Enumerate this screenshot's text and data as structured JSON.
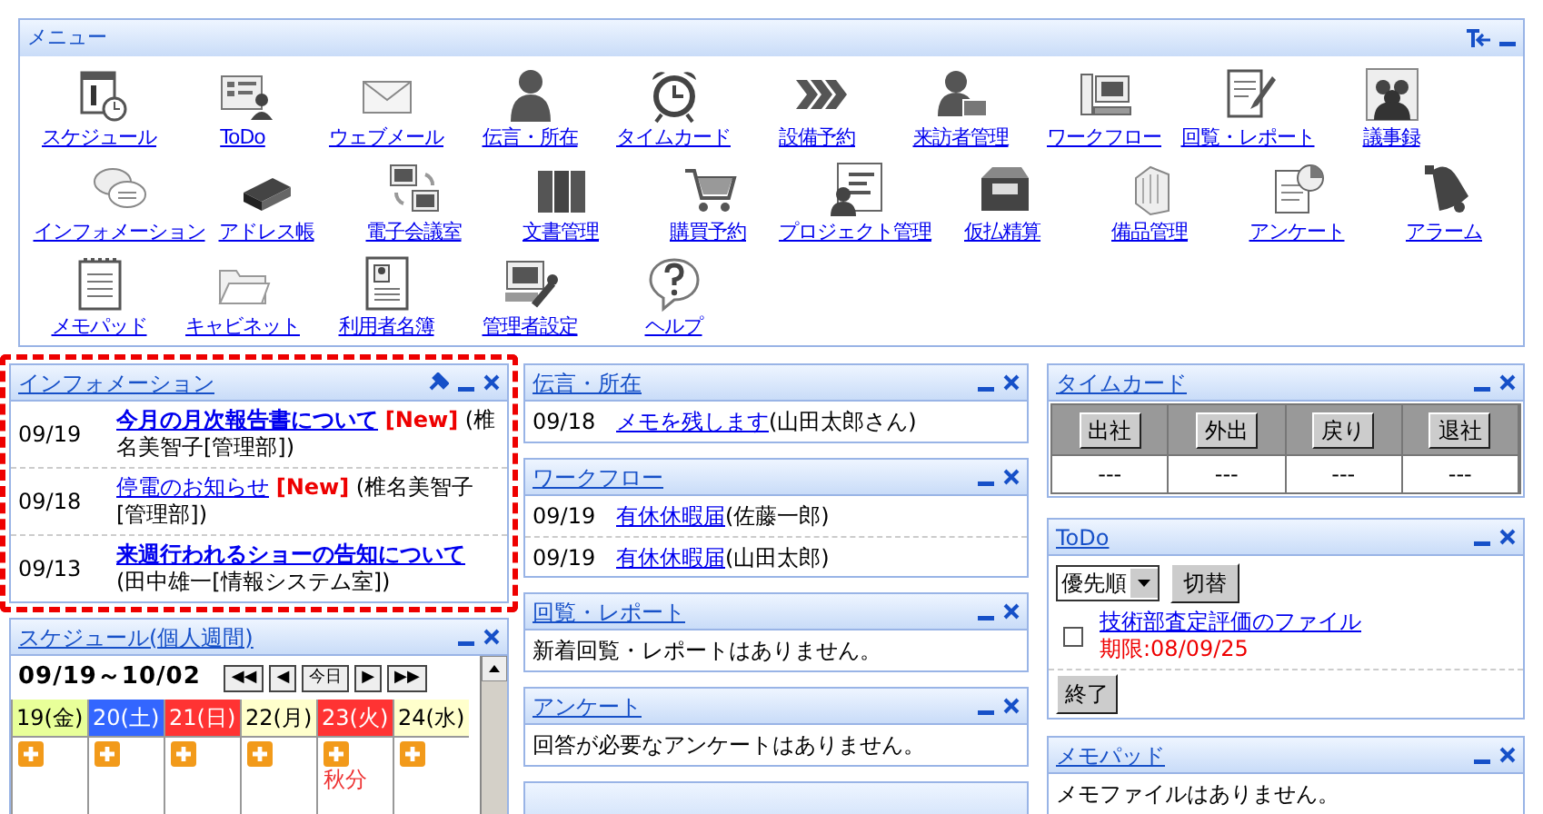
{
  "menu": {
    "title": "メニュー",
    "rows": [
      [
        "スケジュール",
        "ToDo",
        "ウェブメール",
        "伝言・所在",
        "タイムカード",
        "設備予約",
        "来訪者管理",
        "ワークフロー",
        "回覧・レポート",
        "議事録"
      ],
      [
        "インフォメーション",
        "アドレス帳",
        "電子会議室",
        "文書管理",
        "購買予約",
        "プロジェクト管理",
        "仮払精算",
        "備品管理",
        "アンケート",
        "アラーム"
      ],
      [
        "メモパッド",
        "キャビネット",
        "利用者名簿",
        "管理者設定",
        "ヘルプ"
      ]
    ]
  },
  "information": {
    "title": "インフォメーション",
    "highlighted": true,
    "items": [
      {
        "date": "09/19",
        "title": "今月の月次報告書について",
        "bold": true,
        "new": true,
        "new_label": "[New]",
        "author": "(椎名美智子[管理部])"
      },
      {
        "date": "09/18",
        "title": "停電のお知らせ",
        "bold": false,
        "new": true,
        "new_label": "[New]",
        "author": "(椎名美智子[管理部])"
      },
      {
        "date": "09/13",
        "title": "来週行われるショーの告知について",
        "bold": true,
        "new": false,
        "author": "(田中雄一[情報システム室])"
      }
    ]
  },
  "schedule": {
    "title": "スケジュール(個人週間)",
    "range": "09/19～10/02",
    "nav": [
      "◀◀",
      "◀",
      "今日",
      "▶",
      "▶▶"
    ],
    "days": [
      {
        "label": "19(金)",
        "color": "#e8ff99"
      },
      {
        "label": "20(土)",
        "color": "#3366ff"
      },
      {
        "label": "21(日)",
        "color": "#ff3333"
      },
      {
        "label": "22(月)",
        "color": "#ffffcc"
      },
      {
        "label": "23(火)",
        "color": "#ff3333",
        "note": "秋分"
      },
      {
        "label": "24(水)",
        "color": "#ffffcc"
      }
    ]
  },
  "messages": {
    "title": "伝言・所在",
    "items": [
      {
        "date": "09/18",
        "link": "メモを残します",
        "who": "(山田太郎さん)"
      }
    ]
  },
  "workflow": {
    "title": "ワークフロー",
    "items": [
      {
        "date": "09/19",
        "link": "有休休暇届",
        "who": "(佐藤一郎)"
      },
      {
        "date": "09/19",
        "link": "有休休暇届",
        "who": "(山田太郎)"
      }
    ]
  },
  "circular": {
    "title": "回覧・レポート",
    "message": "新着回覧・レポートはありません。"
  },
  "survey": {
    "title": "アンケート",
    "message": "回答が必要なアンケートはありません。"
  },
  "timecard": {
    "title": "タイムカード",
    "columns": [
      {
        "button": "出社",
        "value": "---"
      },
      {
        "button": "外出",
        "value": "---"
      },
      {
        "button": "戻り",
        "value": "---"
      },
      {
        "button": "退社",
        "value": "---"
      }
    ]
  },
  "todo": {
    "title": "ToDo",
    "sort": "優先順",
    "switch_button": "切替",
    "items": [
      {
        "title": "技術部査定評価のファイル",
        "deadline": "期限:08/09/25",
        "checked": false
      }
    ],
    "finish_button": "終了"
  },
  "memopad": {
    "title": "メモパッド",
    "message": "メモファイルはありません。"
  }
}
